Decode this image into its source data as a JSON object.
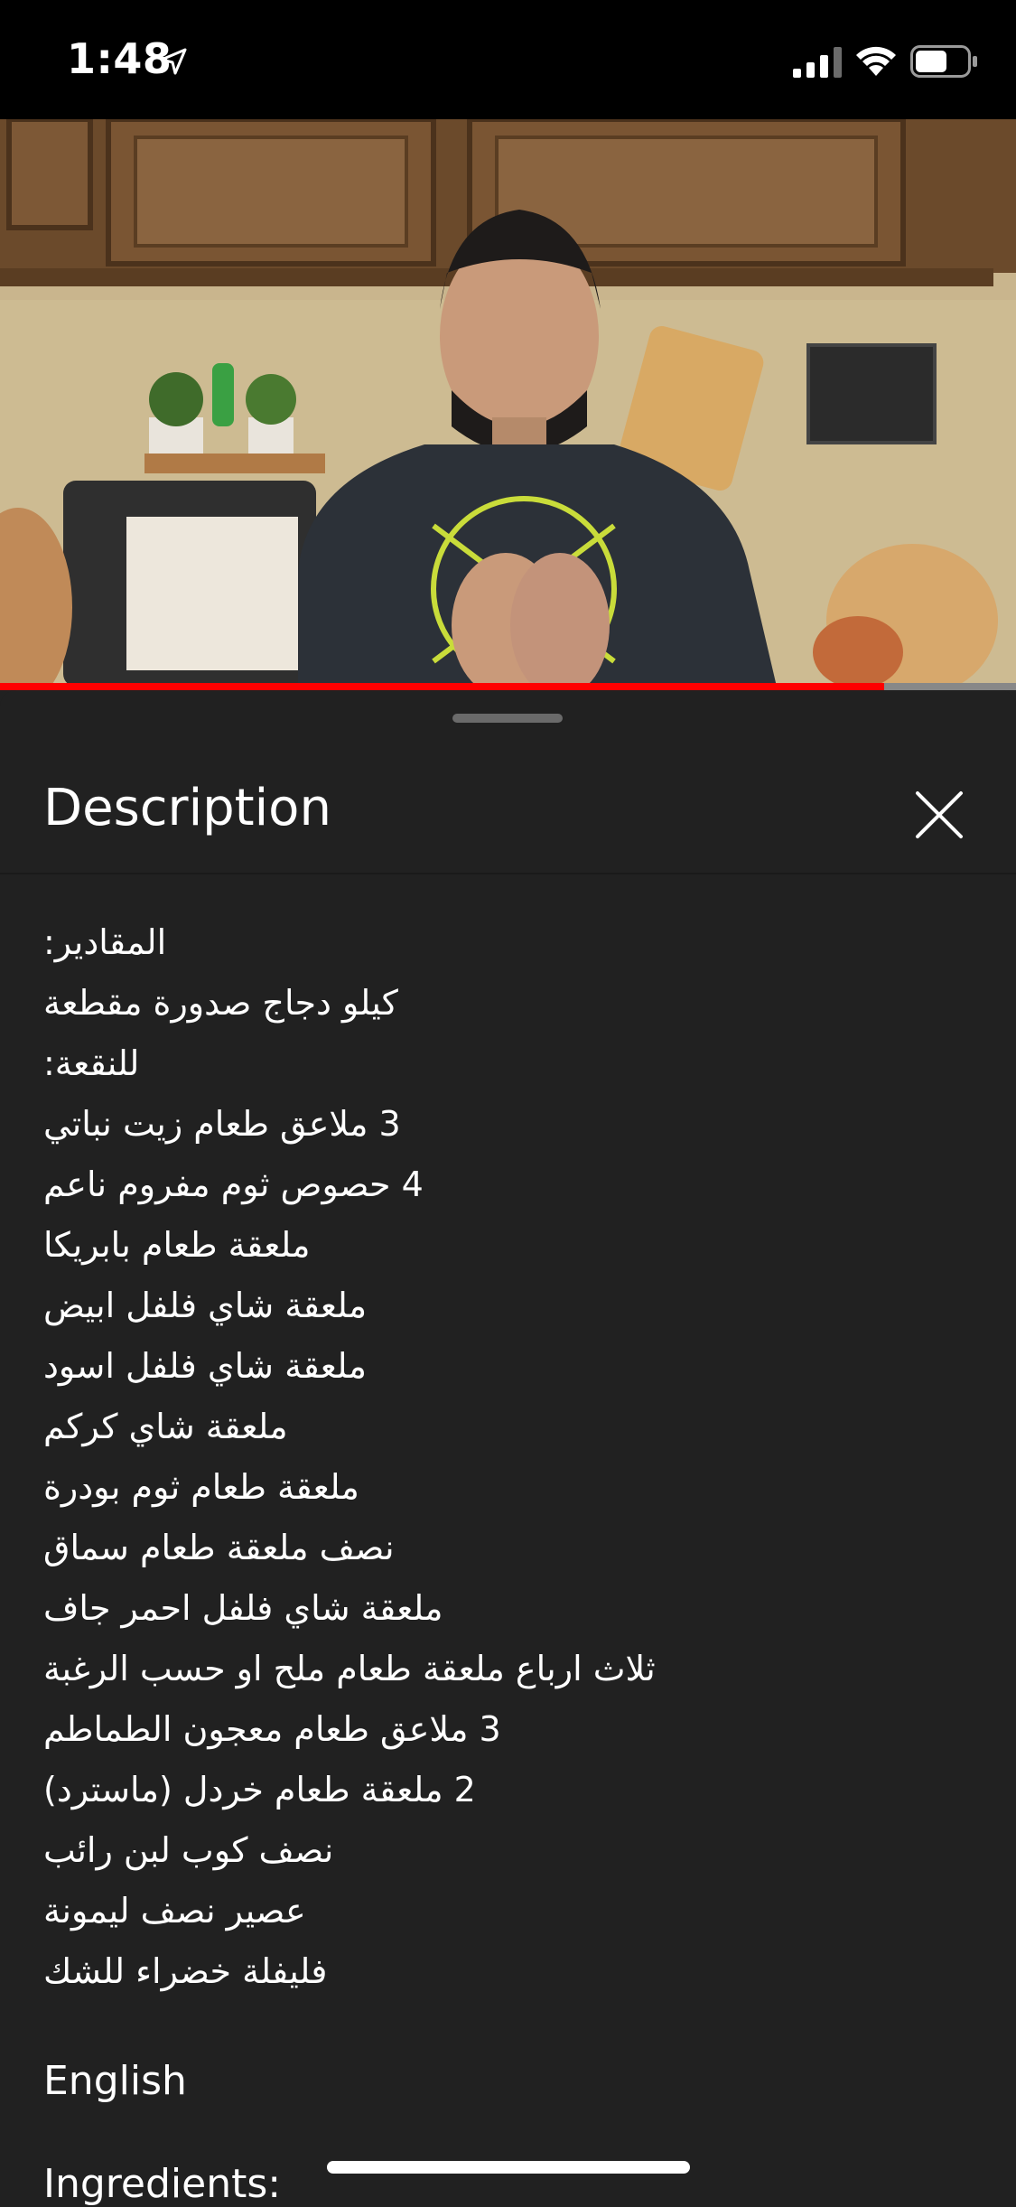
{
  "status_bar": {
    "time": "1:48"
  },
  "video": {
    "progress_fraction": 0.87
  },
  "sheet": {
    "title": "Description",
    "lines": [
      "المقادير:",
      "كيلو دجاج صدورة مقطعة",
      "للنقعة:",
      "3 ملاعق طعام زيت نباتي",
      "4 حصوص ثوم مفروم ناعم",
      "ملعقة طعام بابريكا",
      "ملعقة شاي فلفل ابيض",
      "ملعقة شاي فلفل اسود",
      "ملعقة شاي كركم",
      "ملعقة طعام ثوم بودرة",
      "نصف ملعقة طعام سماق",
      "ملعقة شاي فلفل احمر جاف",
      "ثلاث ارباع ملعقة طعام ملح او حسب الرغبة",
      "3 ملاعق طعام معجون الطماطم",
      "2 ملعقة طعام خردل (ماسترد)",
      "نصف كوب لبن رائب",
      "عصير نصف ليمونة",
      "فليفلة خضراء للشك"
    ],
    "english_label": "English",
    "ingredients_label": "Ingredients:"
  },
  "colors": {
    "progress": "#ff0000",
    "sheet_background": "#212121"
  }
}
